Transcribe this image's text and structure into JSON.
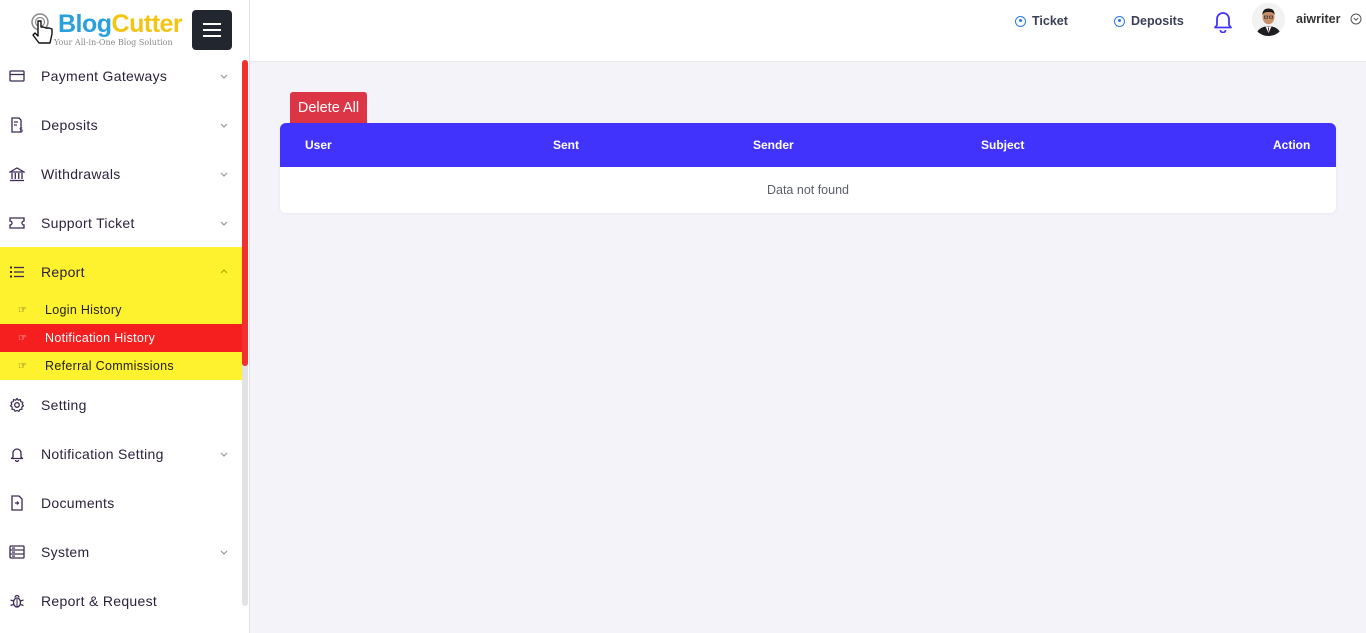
{
  "brand": {
    "name_part1": "Blog",
    "name_part2": "Cutter",
    "tagline": "Your All-in-One Blog Solution"
  },
  "sidebar": {
    "items": [
      {
        "label": "Payment Gateways",
        "icon": "credit-card-icon",
        "has_chevron": true
      },
      {
        "label": "Deposits",
        "icon": "receipt-dollar-icon",
        "has_chevron": true
      },
      {
        "label": "Withdrawals",
        "icon": "bank-icon",
        "has_chevron": true
      },
      {
        "label": "Support Ticket",
        "icon": "ticket-icon",
        "has_chevron": true
      },
      {
        "label": "Report",
        "icon": "list-icon",
        "has_chevron": true,
        "expanded": true
      }
    ],
    "report_sub": [
      {
        "label": "Login History",
        "icon": "hand-point-right-icon"
      },
      {
        "label": "Notification History",
        "icon": "hand-point-right-icon",
        "current": true
      },
      {
        "label": "Referral Commissions",
        "icon": "hand-point-right-icon"
      }
    ],
    "items_after": [
      {
        "label": "Setting",
        "icon": "gear-icon",
        "has_chevron": false
      },
      {
        "label": "Notification Setting",
        "icon": "bell-icon",
        "has_chevron": true
      },
      {
        "label": "Documents",
        "icon": "document-icon",
        "has_chevron": false
      },
      {
        "label": "System",
        "icon": "server-icon",
        "has_chevron": true
      },
      {
        "label": "Report & Request",
        "icon": "bug-icon",
        "has_chevron": false
      }
    ]
  },
  "topbar": {
    "ticket_label": "Ticket",
    "deposits_label": "Deposits",
    "username": "aiwriter"
  },
  "content": {
    "delete_all_label": "Delete All",
    "table": {
      "columns": [
        "User",
        "Sent",
        "Sender",
        "Subject",
        "Action"
      ],
      "empty_text": "Data not found"
    }
  },
  "colors": {
    "header_blue": "#4233fc",
    "active_yellow": "#fef12d",
    "current_red": "#f51f1f",
    "danger": "#dc3545"
  }
}
